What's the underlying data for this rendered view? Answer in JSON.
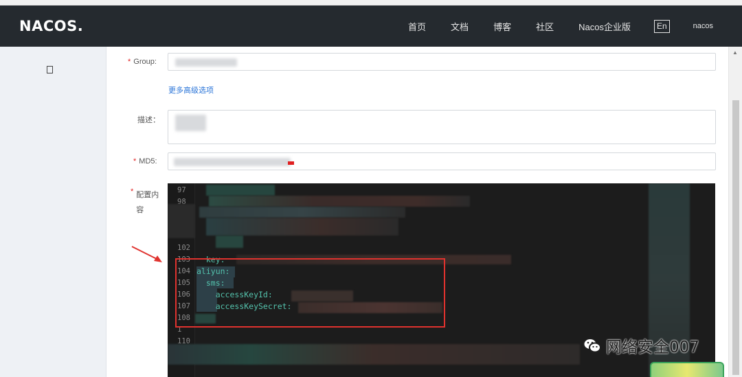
{
  "navbar": {
    "logo": "NACOS.",
    "links": [
      "首页",
      "文档",
      "博客",
      "社区",
      "Nacos企业版"
    ],
    "lang": "En",
    "user": "nacos"
  },
  "form": {
    "group_label": "Group:",
    "advanced_link": "更多高级选项",
    "description_label": "描述：",
    "md5_label": "MD5:",
    "content_label": "配置内容",
    "required_mark": "*"
  },
  "editor": {
    "line_numbers": [
      "97",
      "98",
      "102",
      "103",
      "104",
      "105",
      "106",
      "107",
      "108",
      "1",
      "110"
    ],
    "lines": [
      "  key:",
      "aliyun:",
      "  sms:",
      "    accessKeyId:",
      "    accessKeySecret:"
    ]
  },
  "watermark": {
    "text": "网络安全007"
  },
  "colors": {
    "navbar": "#252a2f",
    "code": "#54c3ad",
    "highlight_box": "#e0322e",
    "link": "#2b75d8"
  }
}
